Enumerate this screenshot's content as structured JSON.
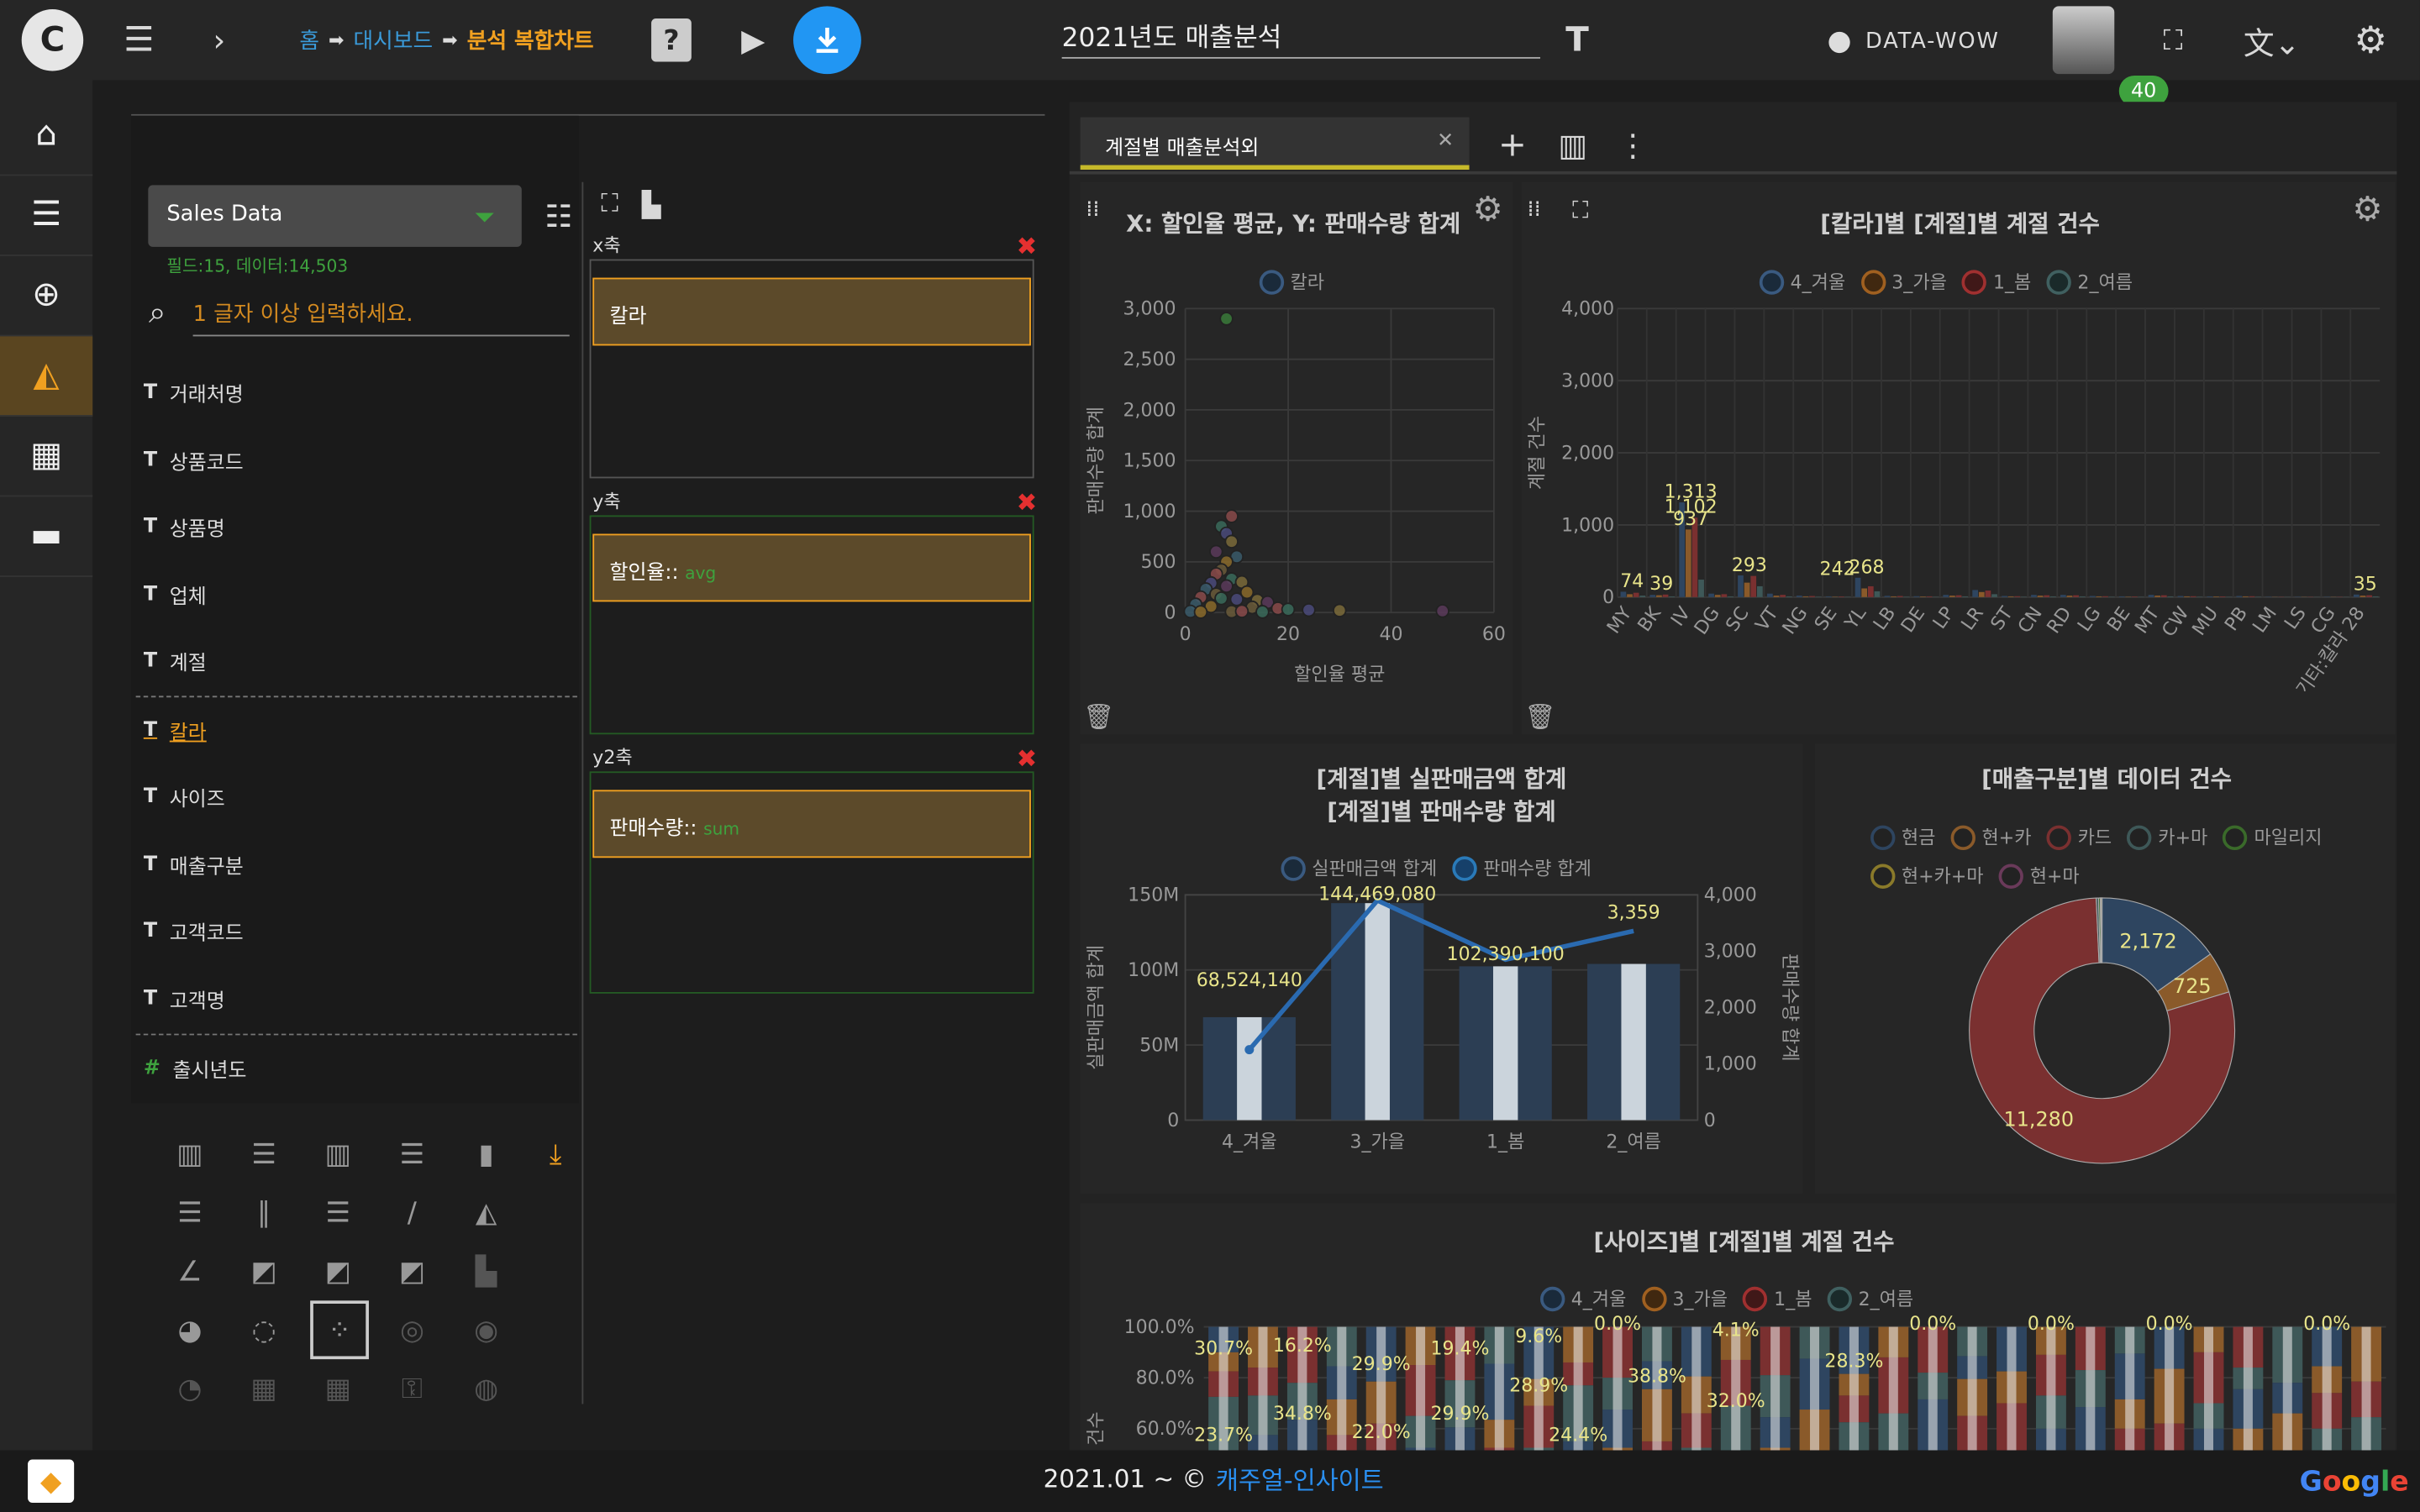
{
  "header": {
    "breadcrumb": {
      "home": "홈",
      "dashboard": "대시보드",
      "current": "분석 복합차트"
    },
    "title_value": "2021년도 매출분석",
    "username": "DATA-WOW",
    "notification_count": "40"
  },
  "datasource": {
    "name": "Sales Data",
    "info": "필드:15, 데이터:14,503"
  },
  "search": {
    "placeholder": "1 글자 이상 입력하세요."
  },
  "fields": [
    "거래처명",
    "상품코드",
    "상품명",
    "업체",
    "계절",
    "칼라",
    "사이즈",
    "매출구분",
    "고객코드",
    "고객명"
  ],
  "numeric_fields": [
    "출시년도"
  ],
  "selected_field": "칼라",
  "axes": {
    "x": {
      "label": "x축",
      "chip": "칼라"
    },
    "y": {
      "label": "y축",
      "chip": "할인율::",
      "agg": "avg"
    },
    "y2": {
      "label": "y2축",
      "chip": "판매수량::",
      "agg": "sum"
    }
  },
  "tab": {
    "label": "계절별 매출분석외"
  },
  "charts": {
    "scatter": {
      "title": "X: 할인율 평균, Y: 판매수량 합계",
      "legend": "칼라",
      "xlabel": "할인율 평균",
      "ylabel": "판매수량 합계"
    },
    "stacked": {
      "title": "[칼라]별 [계절]별 계절 건수",
      "ylabel": "계절 건수"
    },
    "combo": {
      "title1": "[계절]별 실판매금액 합계",
      "title2": "[계절]별 판매수량 합계",
      "legend1": "실판매금액 합계",
      "legend2": "판매수량 합계",
      "ylabel": "실판매금액 합계",
      "y2label": "판매수량 합계"
    },
    "donut": {
      "title": "[매출구분]별 데이터 건수"
    },
    "pct": {
      "title": "[사이즈]별 [계절]별 계절 건수",
      "ylabel": "건수"
    }
  },
  "season_legend": [
    "4_겨울",
    "3_가을",
    "1_봄",
    "2_여름"
  ],
  "footer": {
    "copyright": "2021.01 ~ ©",
    "brand": "캐주얼-인사이트",
    "google": "Google"
  },
  "colors": {
    "accent": "#f0a020",
    "link": "#3a9ad9",
    "green": "#3ea23e",
    "danger": "#e53030"
  },
  "chart_data": [
    {
      "type": "scatter",
      "title": "X: 할인율 평균, Y: 판매수량 합계",
      "xlabel": "할인율 평균",
      "ylabel": "판매수량 합계",
      "xlim": [
        0,
        60
      ],
      "ylim": [
        0,
        3000
      ],
      "legend": [
        "칼라"
      ],
      "points": [
        [
          8,
          2900
        ],
        [
          9,
          950
        ],
        [
          7,
          850
        ],
        [
          8,
          780
        ],
        [
          9,
          700
        ],
        [
          6,
          600
        ],
        [
          10,
          550
        ],
        [
          8,
          500
        ],
        [
          7,
          420
        ],
        [
          6,
          380
        ],
        [
          9,
          330
        ],
        [
          5,
          290
        ],
        [
          11,
          300
        ],
        [
          8,
          260
        ],
        [
          4,
          230
        ],
        [
          12,
          200
        ],
        [
          6,
          180
        ],
        [
          3,
          150
        ],
        [
          7,
          140
        ],
        [
          10,
          130
        ],
        [
          14,
          120
        ],
        [
          16,
          100
        ],
        [
          2,
          80
        ],
        [
          5,
          60
        ],
        [
          13,
          50
        ],
        [
          18,
          40
        ],
        [
          20,
          30
        ],
        [
          24,
          25
        ],
        [
          30,
          20
        ],
        [
          50,
          15
        ],
        [
          1,
          10
        ],
        [
          3,
          5
        ],
        [
          9,
          8
        ],
        [
          11,
          12
        ],
        [
          15,
          6
        ]
      ]
    },
    {
      "type": "bar",
      "title": "[칼라]별 [계절]별 계절 건수",
      "ylabel": "계절 건수",
      "ylim": [
        0,
        4000
      ],
      "categories": [
        "MY",
        "BK",
        "IV",
        "DG",
        "SC",
        "VT",
        "NG",
        "SE",
        "YL",
        "LB",
        "DE",
        "LP",
        "LR",
        "ST",
        "CN",
        "RD",
        "LG",
        "BE",
        "MT",
        "CW",
        "MU",
        "PB",
        "LM",
        "LS",
        "CG",
        "기타:칼라 28"
      ],
      "series": [
        {
          "name": "4_겨울",
          "values": [
            74,
            30,
            1313,
            48,
            300,
            48,
            20,
            10,
            268,
            17,
            12,
            30,
            98,
            15,
            30,
            30,
            15,
            10,
            30,
            15,
            10,
            15,
            5,
            5,
            5,
            35
          ]
        },
        {
          "name": "3_가을",
          "values": [
            40,
            25,
            937,
            30,
            200,
            20,
            10,
            5,
            120,
            10,
            8,
            20,
            70,
            10,
            20,
            20,
            10,
            5,
            20,
            10,
            8,
            10,
            3,
            3,
            3,
            20
          ]
        },
        {
          "name": "1_봄",
          "values": [
            60,
            35,
            1102,
            40,
            293,
            30,
            15,
            8,
            150,
            15,
            10,
            25,
            90,
            12,
            25,
            25,
            12,
            8,
            25,
            12,
            9,
            12,
            4,
            4,
            4,
            25
          ]
        },
        {
          "name": "2_여름",
          "values": [
            20,
            10,
            242,
            10,
            150,
            10,
            5,
            3,
            80,
            5,
            3,
            10,
            40,
            5,
            10,
            10,
            5,
            3,
            10,
            5,
            3,
            5,
            2,
            2,
            2,
            10
          ]
        }
      ],
      "data_labels": [
        "74",
        "39",
        "1,313",
        "937",
        "1,102",
        "293",
        "242",
        "268",
        "35"
      ]
    },
    {
      "type": "bar",
      "title": "[계절]별 실판매금액 합계 / [계절]별 판매수량 합계",
      "categories": [
        "4_겨울",
        "3_가을",
        "1_봄",
        "2_여름"
      ],
      "series": [
        {
          "name": "실판매금액 합계",
          "values": [
            68524140,
            144469080,
            102390100,
            104000000
          ],
          "axis": "y"
        },
        {
          "name": "판매수량 합계",
          "values": [
            1250,
            3900,
            2850,
            3359
          ],
          "axis": "y2",
          "type": "line"
        }
      ],
      "data_labels": [
        "68,524,140",
        "144,469,080",
        "102,390,100",
        "3,359"
      ],
      "ylim": [
        0,
        150000000
      ],
      "y2lim": [
        0,
        4000
      ],
      "ylabel": "실판매금액 합계",
      "y2label": "판매수량 합계"
    },
    {
      "type": "pie",
      "title": "[매출구분]별 데이터 건수",
      "labels": [
        "현금",
        "현+카",
        "카드",
        "카+마",
        "마일리지",
        "현+카+마",
        "현+마"
      ],
      "values": [
        2172,
        725,
        11280,
        40,
        30,
        20,
        10
      ]
    },
    {
      "type": "bar",
      "title": "[사이즈]별 [계절]별 계절 건수",
      "ylabel": "건수",
      "ylim": [
        60,
        100
      ],
      "series": [
        {
          "name": "4_겨울",
          "values": []
        },
        {
          "name": "3_가을",
          "values": []
        },
        {
          "name": "1_봄",
          "values": []
        },
        {
          "name": "2_여름",
          "values": []
        }
      ],
      "data_labels": [
        "30.7%",
        "23.7%",
        "16.2%",
        "34.8%",
        "29.9%",
        "22.0%",
        "19.4%",
        "29.9%",
        "9.6%",
        "28.9%",
        "24.4%",
        "0.0%",
        "38.8%",
        "4.1%",
        "32.0%",
        "28.3%",
        "0.0%",
        "0.0%",
        "0.0%",
        "0.0%"
      ]
    }
  ]
}
